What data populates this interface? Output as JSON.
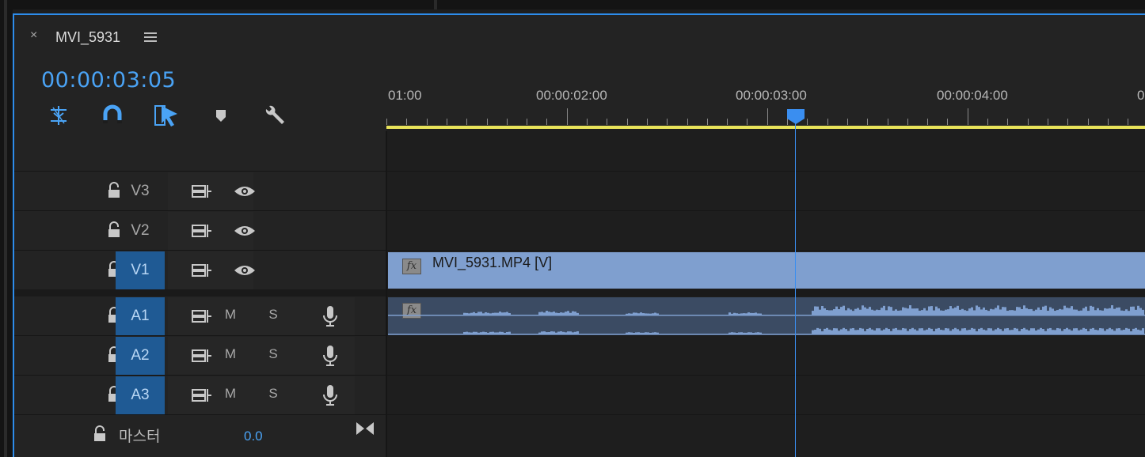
{
  "panel": {
    "tab_title": "MVI_5931",
    "close_glyph": "×",
    "timecode": "00:00:03:05"
  },
  "toolbar": {
    "icons": [
      "insert-overwrite-icon",
      "snap-magnet-icon",
      "linked-selection-icon",
      "add-marker-icon",
      "timeline-settings-wrench-icon"
    ]
  },
  "ruler": {
    "labels": [
      "01:00",
      "00:00:02:00",
      "00:00:03:00",
      "00:00:04:00",
      "0"
    ]
  },
  "tracks": {
    "video": [
      {
        "name": "V3",
        "targeted": false
      },
      {
        "name": "V2",
        "targeted": false
      },
      {
        "name": "V1",
        "targeted": true
      }
    ],
    "audio": [
      {
        "name": "A1",
        "targeted": true,
        "mute": "M",
        "solo": "S"
      },
      {
        "name": "A2",
        "targeted": true,
        "mute": "M",
        "solo": "S"
      },
      {
        "name": "A3",
        "targeted": true,
        "mute": "M",
        "solo": "S"
      }
    ],
    "master": {
      "label": "마스터",
      "value": "0.0"
    }
  },
  "clips": {
    "video_clip_name": "MVI_5931.MP4 [V]",
    "fx_label": "fx"
  },
  "colors": {
    "accent": "#4aa3f5",
    "playhead": "#3a8ef0",
    "work_area": "#e8e35a",
    "video_clip": "#7f9fcf",
    "audio_clip": "#3b4b63",
    "target_on": "#1f5a94"
  }
}
